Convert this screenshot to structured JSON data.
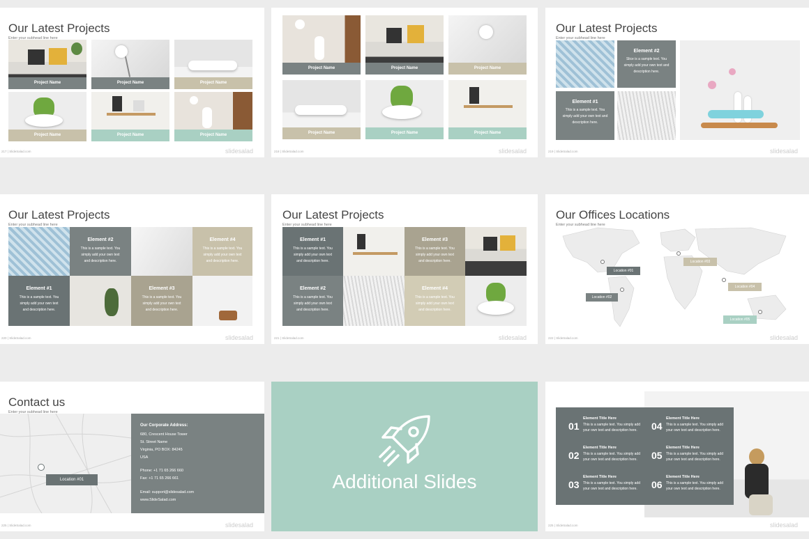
{
  "brand": "slidesalad",
  "footer": "| SlideSalad.com",
  "subhead": "Enter your subhead line here",
  "colors": {
    "gray": "#7a8282",
    "beige": "#c8c1aa",
    "mint": "#a9d0c3",
    "dark": "#6a7374"
  },
  "slide1": {
    "title": "Our Latest Projects",
    "page": "217",
    "captions": [
      "Project Name",
      "Project Name",
      "Project Name",
      "Project Name",
      "Project Name",
      "Project Name"
    ]
  },
  "slide2": {
    "page": "218",
    "captions": [
      "Project Name",
      "Project Name",
      "Project Name",
      "Project Name",
      "Project Name",
      "Project Name"
    ]
  },
  "slide3": {
    "title": "Our Latest Projects",
    "page": "219",
    "el2": {
      "title": "Element #2",
      "desc": "Slice is a sample text. You simply add your own text and description here."
    },
    "el1": {
      "title": "Element #1",
      "desc": "This is a sample text. You simply add your own text and description here."
    }
  },
  "slide4": {
    "title": "Our Latest Projects",
    "page": "220",
    "elements": [
      {
        "title": "Element #2",
        "desc": "This is a sample text. You simply add your own text and description here."
      },
      {
        "title": "Element #4",
        "desc": "This is a sample text. You simply add your own text and description here."
      },
      {
        "title": "Element #1",
        "desc": "This is a sample text. You simply add your own text and description here."
      },
      {
        "title": "Element #3",
        "desc": "This is a sample text. You simply add your own text and description here."
      }
    ]
  },
  "slide5": {
    "title": "Our Latest Projects",
    "page": "221",
    "elements": [
      {
        "title": "Element #1",
        "desc": "This is a sample text. You simply add your own text and description here."
      },
      {
        "title": "Element #3",
        "desc": "This is a sample text. You simply add your own text and description here."
      },
      {
        "title": "Element #2",
        "desc": "This is a sample text. You simply add your own text and description here."
      },
      {
        "title": "Element #4",
        "desc": "This is a sample text. You simply add your own text and description here."
      }
    ]
  },
  "slide6": {
    "title": "Our Offices Locations",
    "page": "222",
    "locations": [
      "Location #01",
      "Location #02",
      "Location #03",
      "Location #04",
      "Location #05"
    ]
  },
  "slide7": {
    "title": "Contact us",
    "page": "223",
    "map_location": "Location #01",
    "address_title": "Our Corporate Address:",
    "address_lines": [
      "680, Crescent House Tower",
      "St. Street Name",
      "Virginia, PO BOX: 84245",
      "USA"
    ],
    "phone": "Phone:  +1 71 65 266 660",
    "fax": "Fax:    +1 71 65 266 661",
    "email": "Email:  support@slidesalad.com",
    "web": "www.SlideSalad.com"
  },
  "slide8": {
    "title": "Additional Slides"
  },
  "slide9": {
    "page": "225",
    "items": [
      {
        "num": "01",
        "title": "Element Title Here",
        "desc": "This is a sample text. You simply add your own text and description here."
      },
      {
        "num": "02",
        "title": "Element Title Here",
        "desc": "This is a sample text. You simply add your own text and description here."
      },
      {
        "num": "03",
        "title": "Element Title Here",
        "desc": "This is a sample text. You simply add your own text and description here."
      },
      {
        "num": "04",
        "title": "Element Title Here",
        "desc": "This is a sample text. You simply add your own text and description here."
      },
      {
        "num": "05",
        "title": "Element Title Here",
        "desc": "This is a sample text. You simply add your own text and description here."
      },
      {
        "num": "06",
        "title": "Element Title Here",
        "desc": "This is a sample text. You simply add your own text and description here."
      }
    ]
  }
}
